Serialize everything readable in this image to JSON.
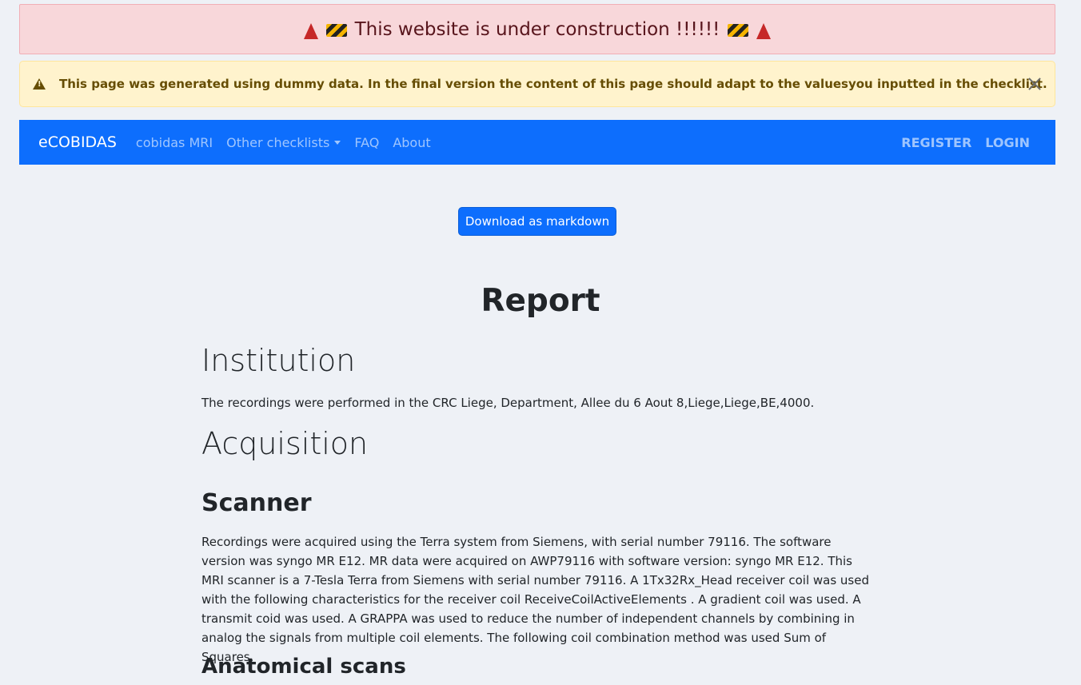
{
  "construction_banner": {
    "text": "This website is under construction !!!!!!"
  },
  "alert": {
    "message": "This page was generated using dummy data. In the final version the content of this page should adapt to the valuesyou inputted in the checklist."
  },
  "navbar": {
    "brand": "eCOBIDAS",
    "links": [
      {
        "label": "cobidas MRI"
      },
      {
        "label": "Other checklists"
      },
      {
        "label": "FAQ"
      },
      {
        "label": "About"
      }
    ],
    "right_links": [
      {
        "label": "REGISTER"
      },
      {
        "label": "LOGIN"
      }
    ]
  },
  "download_button": {
    "label": "Download as markdown"
  },
  "report": {
    "title": "Report",
    "institution_heading": "Institution",
    "institution_text": "The recordings were performed in the CRC Liege, Department, Allee du 6 Aout 8,Liege,Liege,BE,4000.",
    "acquisition_heading": "Acquisition",
    "scanner_heading": "Scanner",
    "scanner_text": "Recordings were acquired using the Terra system from Siemens, with serial number 79116. The software version was syngo MR E12. MR data were acquired on AWP79116 with software version: syngo MR E12. This MRI scanner is a 7-Tesla Terra from Siemens with serial number 79116. A 1Tx32Rx_Head receiver coil was used with the following characteristics for the receiver coil ReceiveCoilActiveElements . A gradient coil was used. A transmit coid was used. A GRAPPA was used to reduce the number of independent channels by combining in analog the signals from multiple coil elements. The following coil combination method was used Sum of Squares.",
    "anatomical_heading": "Anatomical scans"
  }
}
